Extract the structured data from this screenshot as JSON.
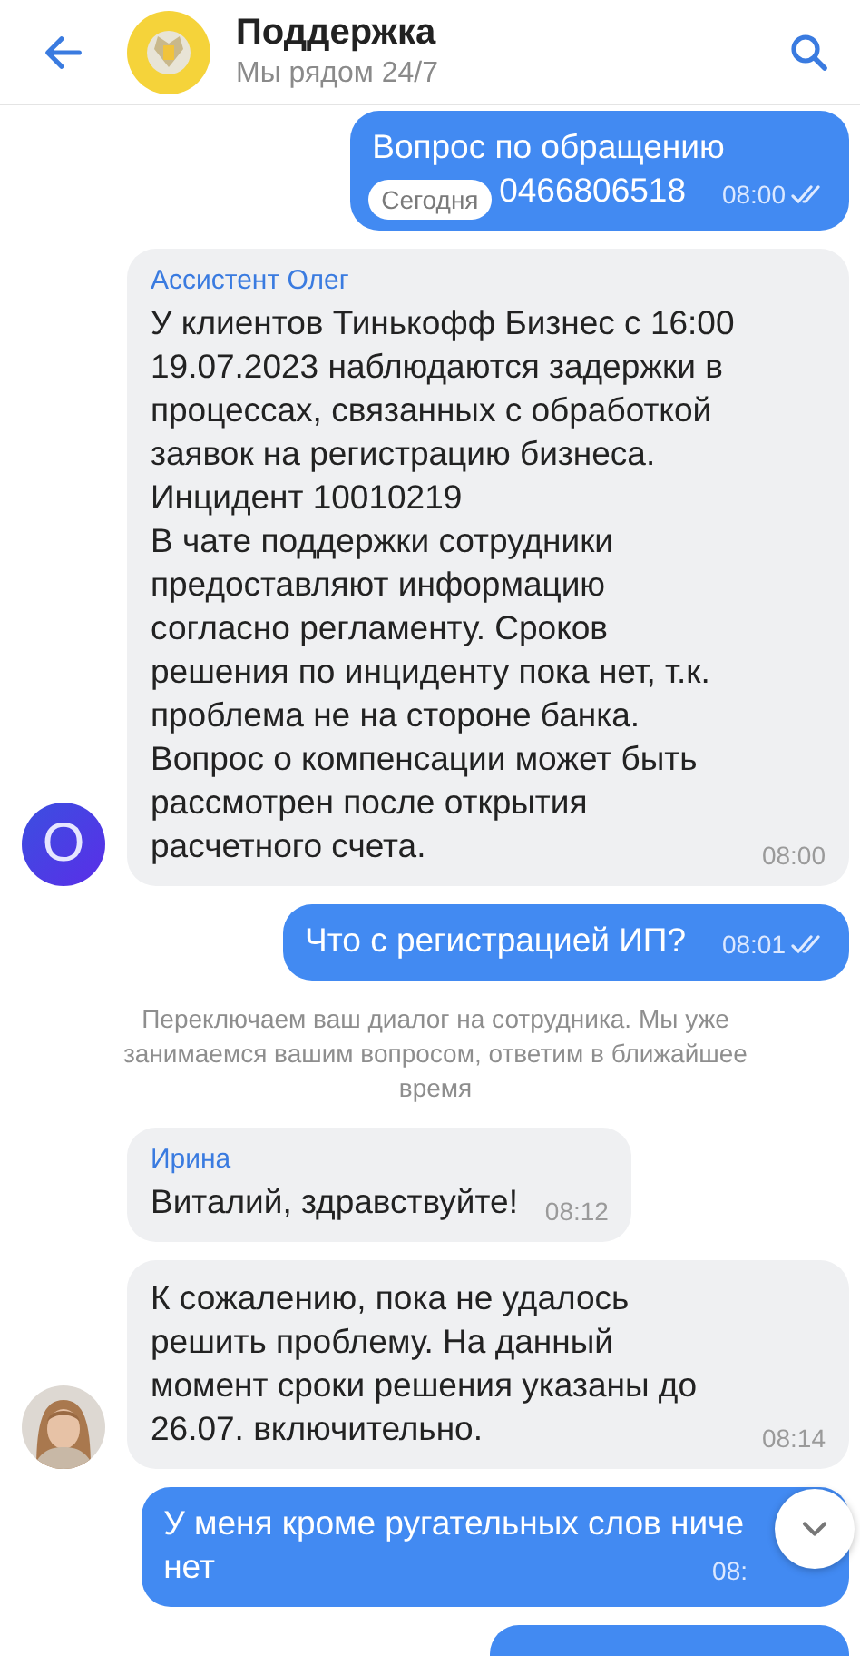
{
  "header": {
    "title": "Поддержка",
    "subtitle": "Мы рядом 24/7"
  },
  "messages": [
    {
      "kind": "outgoing",
      "lines": [
        "Вопрос по обращению",
        "0466806518"
      ],
      "time": "08:00",
      "read": true,
      "date_badge": "Сегодня"
    },
    {
      "kind": "incoming",
      "author": "Ассистент Олег",
      "text": "У клиентов Тинькофф Бизнес с 16:00 19.07.2023 наблюдаются задержки в процессах, связанных с обработкой заявок на регистрацию бизнеса. Инцидент 10010219\nВ чате поддержки сотрудники предоставляют информацию согласно регламенту. Сроков решения по инциденту пока нет, т.к. проблема не на стороне банка. Вопрос о компенсации может быть рассмотрен после открытия расчетного счета.",
      "time": "08:00",
      "avatar": {
        "kind": "letter",
        "letter": "O"
      }
    },
    {
      "kind": "outgoing",
      "lines": [
        "Что с регистрацией ИП?"
      ],
      "time": "08:01",
      "read": true
    },
    {
      "kind": "system",
      "text": "Переключаем ваш диалог на сотрудника. Мы уже занимаемся вашим вопросом, ответим в ближайшее время"
    },
    {
      "kind": "incoming",
      "author": "Ирина",
      "text": "Виталий, здравствуйте!",
      "time": "08:12"
    },
    {
      "kind": "incoming",
      "text": "К сожалению, пока не удалось решить проблему. На данный момент сроки решения указаны до 26.07. включительно.",
      "time": "08:14"
    },
    {
      "kind": "outgoing",
      "lines": [
        "У меня кроме ругательных слов ниче",
        "нет"
      ],
      "time": "08:"
    },
    {
      "kind": "partial"
    }
  ]
}
